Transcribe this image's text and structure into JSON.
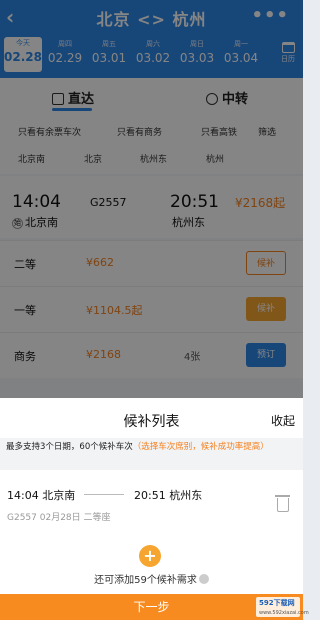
{
  "header": {
    "back_icon": "chevron-left-icon",
    "title": "北京 <> 杭州",
    "more_icon": "more-dots-icon",
    "more_label": "•••"
  },
  "dates": [
    {
      "weekday": "今天",
      "date": "02.28",
      "active": true
    },
    {
      "weekday": "周四",
      "date": "02.29"
    },
    {
      "weekday": "周五",
      "date": "03.01"
    },
    {
      "weekday": "周六",
      "date": "03.02"
    },
    {
      "weekday": "周日",
      "date": "03.03"
    },
    {
      "weekday": "周一",
      "date": "03.04"
    }
  ],
  "calendar": {
    "label": "日历",
    "icon": "calendar-icon"
  },
  "modes": {
    "direct": "直达",
    "transfer": "中转"
  },
  "filters": [
    "只看有余票车次",
    "只看有商务",
    "只看高铁",
    "筛选"
  ],
  "stations": [
    "北京南",
    "北京",
    "杭州东",
    "杭州"
  ],
  "train": {
    "dep_time": "14:04",
    "dep_station": "北京南",
    "dep_tag": "始",
    "number": "G2557",
    "arr_time": "20:51",
    "arr_station": "杭州东",
    "price": "¥2168起"
  },
  "seats": [
    {
      "class": "二等",
      "price": "¥662",
      "count": "",
      "button": "候补"
    },
    {
      "class": "一等",
      "price": "¥1104.5起",
      "count": "",
      "button": "候补"
    },
    {
      "class": "商务",
      "price": "¥2168",
      "count": "4张",
      "button": "预订"
    }
  ],
  "sheet": {
    "title": "候补列表",
    "collapse": "收起",
    "notice_main": "最多支持3个日期，60个候补车次",
    "notice_hint": "（选择车次席别，候补成功率提高）",
    "candidate": {
      "dep": "14:04 北京南",
      "arr": "20:51 杭州东",
      "sub": "G2557  02月28日 二等座"
    },
    "add_label": "+",
    "add_text": "还可添加59个候补需求",
    "next": "下一步"
  },
  "watermark": {
    "main": "592下载网",
    "sub": "www.592xiazai.com"
  },
  "colors": {
    "brand_blue": "#2d86e8",
    "accent_orange": "#f78b1f"
  }
}
